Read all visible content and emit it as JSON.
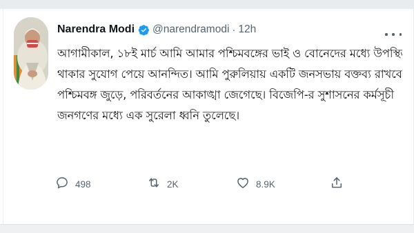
{
  "tweet": {
    "author_name": "Narendra Modi",
    "author_handle": "@narendramodi",
    "separator": "·",
    "timestamp": "12h",
    "text_lines": [
      "আগামীকাল, ১৮ই মার্চ আমি আমার পশ্চিমবঙ্গের ভাই ও বোনেদের মধ্যে উপস্থিত",
      "থাকার সুযোগ পেয়ে আনন্দিত। আমি পুরুলিয়ায় একটি জনসভায় বক্তব্য রাখবো।",
      "পশ্চিমবঙ্গ জুড়ে, পরিবর্তনের আকাঙ্খা জেগেছে। বিজেপি-র সুশাসনের কর্মসূচী",
      "জনগণের মধ্যে এক সুরেলা ধ্বনি তুলেছে।"
    ],
    "actions": {
      "reply": {
        "icon": "reply-icon",
        "count": "498"
      },
      "retweet": {
        "icon": "retweet-icon",
        "count": "2K"
      },
      "like": {
        "icon": "like-icon",
        "count": "8.9K"
      },
      "share": {
        "icon": "share-icon"
      }
    }
  },
  "colors": {
    "verified_badge": "#1d9bf0",
    "text_primary": "#0f1419",
    "text_secondary": "#536471"
  }
}
